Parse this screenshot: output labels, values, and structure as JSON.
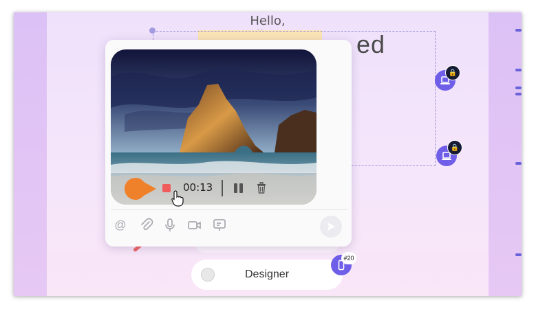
{
  "canvas": {
    "greeting": "Hello, Oliver!",
    "heading_fragment": "ed",
    "designer_label": "Designer",
    "badge_number": "#20"
  },
  "recorder": {
    "elapsed": "00:13",
    "controls": [
      "play",
      "stop",
      "pause",
      "delete"
    ]
  },
  "composer": {
    "tools": [
      "mention-icon",
      "attachment-icon",
      "microphone-icon",
      "video-icon",
      "screen-share-icon"
    ],
    "send": "send-icon"
  },
  "colors": {
    "accent": "#6f5ee8",
    "play": "#f0812b",
    "stop": "#f05b5b",
    "lock_badge": "#161a33"
  }
}
